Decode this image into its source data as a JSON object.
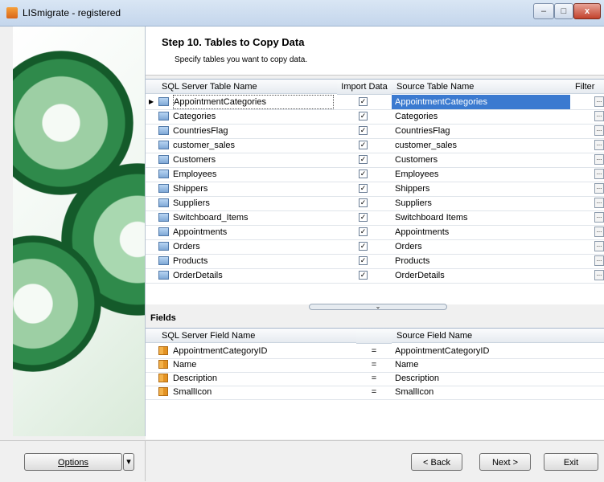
{
  "window": {
    "title": "LISmigrate - registered"
  },
  "header": {
    "title": "Step 10. Tables to Copy Data",
    "subtitle": "Specify tables you want to copy data."
  },
  "tables_grid": {
    "columns": {
      "sql": "SQL Server Table Name",
      "import": "Import Data",
      "source": "Source Table Name",
      "filter": "Filter"
    },
    "rows": [
      {
        "sql": "AppointmentCategories",
        "source": "AppointmentCategories",
        "checked": true
      },
      {
        "sql": "Categories",
        "source": "Categories",
        "checked": true
      },
      {
        "sql": "CountriesFlag",
        "source": "CountriesFlag",
        "checked": true
      },
      {
        "sql": "customer_sales",
        "source": "customer_sales",
        "checked": true
      },
      {
        "sql": "Customers",
        "source": "Customers",
        "checked": true
      },
      {
        "sql": "Employees",
        "source": "Employees",
        "checked": true
      },
      {
        "sql": "Shippers",
        "source": "Shippers",
        "checked": true
      },
      {
        "sql": "Suppliers",
        "source": "Suppliers",
        "checked": true
      },
      {
        "sql": "Switchboard_Items",
        "source": "Switchboard Items",
        "checked": true
      },
      {
        "sql": "Appointments",
        "source": "Appointments",
        "checked": true
      },
      {
        "sql": "Orders",
        "source": "Orders",
        "checked": true
      },
      {
        "sql": "Products",
        "source": "Products",
        "checked": true
      },
      {
        "sql": "OrderDetails",
        "source": "OrderDetails",
        "checked": true
      }
    ],
    "check_mark": "✓",
    "ellipsis": "..."
  },
  "fields": {
    "label": "Fields",
    "columns": {
      "sql": "SQL Server Field Name",
      "source": "Source Field Name"
    },
    "rows": [
      {
        "sql": "AppointmentCategoryID",
        "eq": "=",
        "source": "AppointmentCategoryID"
      },
      {
        "sql": "Name",
        "eq": "=",
        "source": "Name"
      },
      {
        "sql": "Description",
        "eq": "=",
        "source": "Description"
      },
      {
        "sql": "SmallIcon",
        "eq": "=",
        "source": "SmallIcon"
      }
    ]
  },
  "buttons": {
    "options": "Options",
    "back": "< Back",
    "next": "Next >",
    "exit": "Exit"
  },
  "icons": {
    "window": "app-icon",
    "minimize": "minimize-icon",
    "maximize": "maximize-icon",
    "close": "close-icon"
  },
  "colors": {
    "selection": "#3b7ad0",
    "gear_dark": "#1f7a3a",
    "gear_light": "#9dcfa4"
  }
}
